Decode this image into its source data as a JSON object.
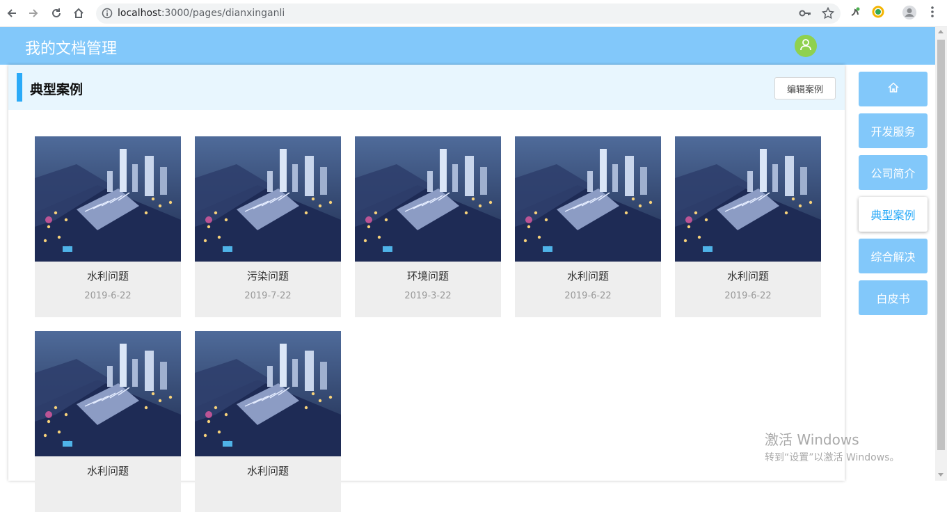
{
  "browser": {
    "url_host": "localhost",
    "url_rest": ":3000/pages/dianxinganli"
  },
  "header": {
    "title": "我的文档管理"
  },
  "section": {
    "title": "典型案例",
    "edit_button": "编辑案例"
  },
  "cases": [
    {
      "name": "水利问题",
      "date": "2019-6-22"
    },
    {
      "name": "污染问题",
      "date": "2019-7-22"
    },
    {
      "name": "环境问题",
      "date": "2019-3-22"
    },
    {
      "name": "水利问题",
      "date": "2019-6-22"
    },
    {
      "name": "水利问题",
      "date": "2019-6-22"
    },
    {
      "name": "水利问题",
      "date": ""
    },
    {
      "name": "水利问题",
      "date": ""
    }
  ],
  "nav": {
    "items": [
      {
        "label": "",
        "icon": "home-icon"
      },
      {
        "label": "开发服务"
      },
      {
        "label": "公司简介"
      },
      {
        "label": "典型案例",
        "active": true
      },
      {
        "label": "综合解决"
      },
      {
        "label": "白皮书"
      }
    ]
  },
  "watermark": {
    "line1": "激活 Windows",
    "line2": "转到“设置”以激活 Windows。"
  },
  "colors": {
    "header_bg": "#82c8fa",
    "accent": "#2aaaf8",
    "avatar": "#8fd14f",
    "card_bg": "#eeeeee"
  }
}
